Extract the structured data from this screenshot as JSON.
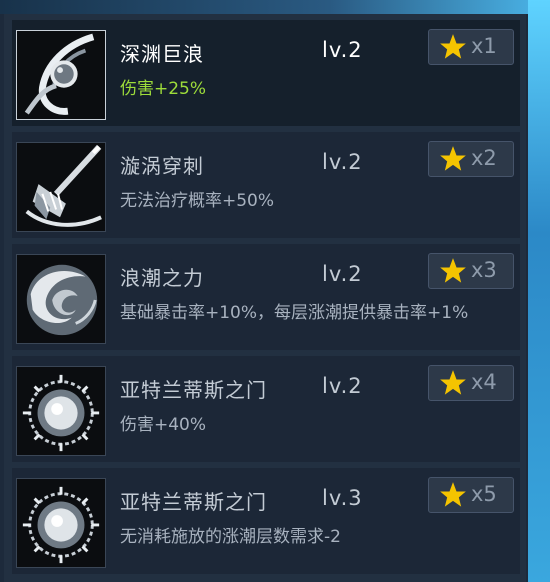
{
  "skills": [
    {
      "name": "深渊巨浪",
      "level": "lv.2",
      "stars": "x1",
      "desc": "伤害+25%",
      "icon": "whirlpool-planet-icon"
    },
    {
      "name": "漩涡穿刺",
      "level": "lv.2",
      "stars": "x2",
      "desc": "无法治疗概率+50%",
      "icon": "water-spear-icon"
    },
    {
      "name": "浪潮之力",
      "level": "lv.2",
      "stars": "x3",
      "desc": "基础暴击率+10%，每层涨潮提供暴击率+1%",
      "icon": "wave-swirl-icon"
    },
    {
      "name": "亚特兰蒂斯之门",
      "level": "lv.2",
      "stars": "x4",
      "desc": "伤害+40%",
      "icon": "portal-orb-icon"
    },
    {
      "name": "亚特兰蒂斯之门",
      "level": "lv.3",
      "stars": "x5",
      "desc": "无消耗施放的涨潮层数需求-2",
      "icon": "portal-orb-icon"
    }
  ],
  "colors": {
    "star": "#f5c400",
    "active_desc": "#9ddc3a"
  }
}
